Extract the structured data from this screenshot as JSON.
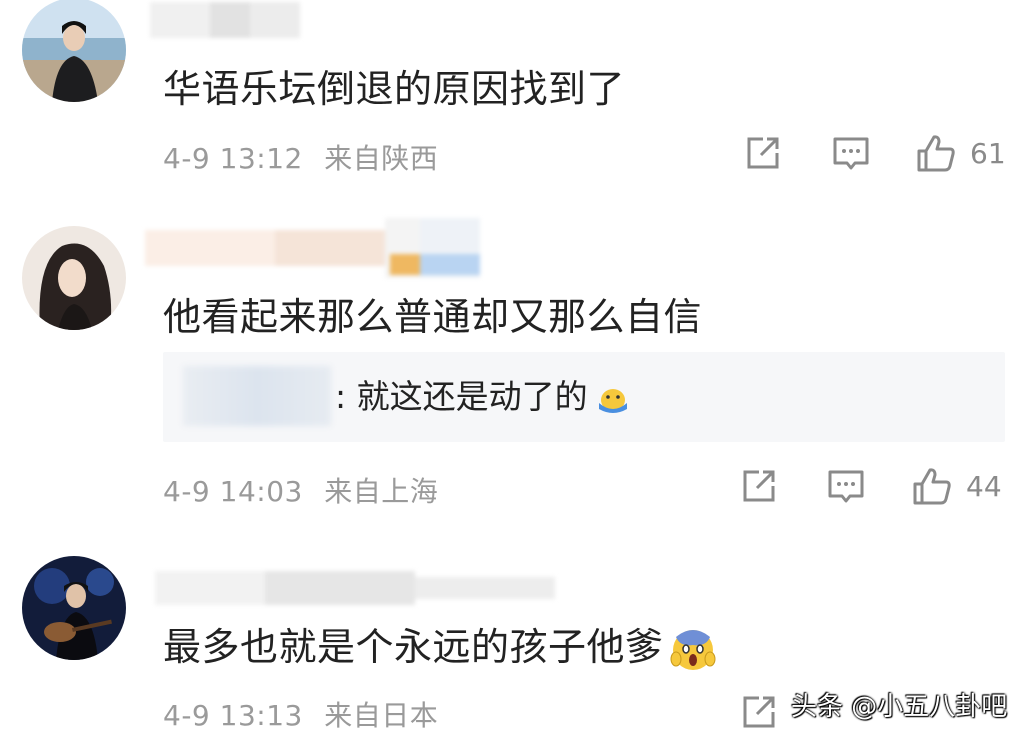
{
  "comments": [
    {
      "text": "华语乐坛倒退的原因找到了",
      "date": "4-9 13:12",
      "location": "来自陕西",
      "likes": "61",
      "icons": {
        "share": "share-icon",
        "comment": "comment-icon",
        "like": "thumbs-up-icon"
      }
    },
    {
      "text": "他看起来那么普通却又那么自信",
      "reply": {
        "text": ": 就这还是动了的",
        "emoji": "hot-face-emoji"
      },
      "date": "4-9 14:03",
      "location": "来自上海",
      "likes": "44",
      "icons": {
        "share": "share-icon",
        "comment": "comment-icon",
        "like": "thumbs-up-icon"
      }
    },
    {
      "text": "最多也就是个永远的孩子他爹",
      "emoji": "screaming-face-emoji",
      "date": "4-9 13:13",
      "location": "来自日本",
      "icons": {
        "share": "share-icon"
      }
    }
  ],
  "watermark": "头条 @小五八卦吧",
  "colors": {
    "text": "#222222",
    "meta": "#9a9a9a",
    "icon": "#8a8a8a",
    "reply_bg": "#f6f7f9"
  }
}
